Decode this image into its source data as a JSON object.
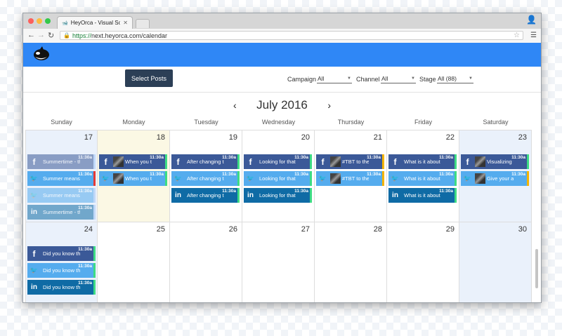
{
  "browser": {
    "tab_title": "HeyOrca - Visual Social Me",
    "url_https": "https://",
    "url_rest": "next.heyorca.com/calendar"
  },
  "toolbar": {
    "select_posts": "Select Posts",
    "campaign_label": "Campaign",
    "campaign_value": "All",
    "channel_label": "Channel",
    "channel_value": "All",
    "stage_label": "Stage",
    "stage_value": "All (88)"
  },
  "calendar": {
    "month_title": "July 2016",
    "prev": "‹",
    "next": "›",
    "weekdays": [
      "Sunday",
      "Monday",
      "Tuesday",
      "Wednesday",
      "Thursday",
      "Friday",
      "Saturday"
    ],
    "weeks": [
      [
        "17",
        "18",
        "19",
        "20",
        "21",
        "22",
        "23"
      ],
      [
        "24",
        "25",
        "26",
        "27",
        "28",
        "29",
        "30"
      ]
    ]
  },
  "posts": {
    "w1": {
      "sun": [
        {
          "net": "fb",
          "text": "Summertime - th...",
          "time": "11:30a",
          "faded": true,
          "status": "#9fc5f8"
        },
        {
          "net": "tw",
          "text": "Summer means ...",
          "time": "11:30a",
          "faded": false,
          "status": "#e53935"
        },
        {
          "net": "tw",
          "text": "Summer means ...",
          "time": "11:30a",
          "faded": true,
          "status": "#9fc5f8"
        },
        {
          "net": "li",
          "text": "Summertime - th...",
          "time": "11:30a",
          "faded": true,
          "status": "#9fc5f8"
        }
      ],
      "mon": [
        {
          "net": "fb",
          "text": "When you th...",
          "time": "11:30a",
          "thumb": true,
          "status": "#3ddc84"
        },
        {
          "net": "tw",
          "text": "When you th...",
          "time": "11:30a",
          "thumb": true,
          "status": "#3ddc84"
        }
      ],
      "tue": [
        {
          "net": "fb",
          "text": "After changing th...",
          "time": "11:30a",
          "status": "#3ddc84"
        },
        {
          "net": "tw",
          "text": "After changing th...",
          "time": "11:30a",
          "status": "#3ddc84"
        },
        {
          "net": "li",
          "text": "After changing th...",
          "time": "11:30a",
          "status": "#3ddc84"
        }
      ],
      "wed": [
        {
          "net": "fb",
          "text": "Looking for that ...",
          "time": "11:30a",
          "status": "#3ddc84"
        },
        {
          "net": "tw",
          "text": "Looking for that ...",
          "time": "11:30a",
          "status": "#3ddc84"
        },
        {
          "net": "li",
          "text": "Looking for that ...",
          "time": "11:30a",
          "status": "#3ddc84"
        }
      ],
      "thu": [
        {
          "net": "fb",
          "text": "#TBT to the ti...",
          "time": "11:30a",
          "thumb": true,
          "status": "#f4b400"
        },
        {
          "net": "tw",
          "text": "#TBT to the ti...",
          "time": "11:30a",
          "thumb": true,
          "status": "#f4b400"
        }
      ],
      "fri": [
        {
          "net": "fb",
          "text": "What is it about ...",
          "time": "11:30a",
          "status": "#3ddc84"
        },
        {
          "net": "tw",
          "text": "What is it about ...",
          "time": "11:30a",
          "status": "#3ddc84"
        },
        {
          "net": "li",
          "text": "What is it about ...",
          "time": "11:30a",
          "status": "#3ddc84"
        }
      ],
      "sat": [
        {
          "net": "fb",
          "text": "Visualizing yo...",
          "time": "11:30a",
          "thumb": true,
          "status": "#3ddc84"
        },
        {
          "net": "tw",
          "text": "Give your au...",
          "time": "11:30a",
          "thumb": true,
          "status": "#f4b400"
        }
      ]
    },
    "w2": {
      "sun": [
        {
          "net": "fb",
          "text": "Did you know th...",
          "time": "11:30a",
          "status": "#3ddc84"
        },
        {
          "net": "tw",
          "text": "Did you know th...",
          "time": "11:30a",
          "status": "#3ddc84"
        },
        {
          "net": "li",
          "text": "Did you know th...",
          "time": "11:30a",
          "status": "#3ddc84"
        }
      ]
    }
  },
  "icons": {
    "fb": "f",
    "tw": "🐦",
    "li": "in"
  }
}
